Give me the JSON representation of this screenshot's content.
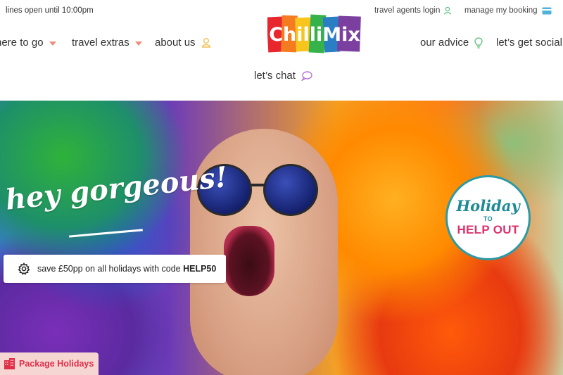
{
  "topbar": {
    "lines_open": "lines open until 10:00pm",
    "agents_login": "travel agents login",
    "manage_booking": "manage my booking"
  },
  "nav": {
    "where_to_go": "here to go",
    "travel_extras": "travel extras",
    "about_us": "about us",
    "our_advice": "our advice",
    "lets_get_social": "let’s get social",
    "lets_chat": "let’s chat"
  },
  "logo": {
    "text": "ChilliMix",
    "colors": [
      "#e8262d",
      "#f47b20",
      "#f7c51e",
      "#36b24a",
      "#2a7ec3",
      "#7b3fa0"
    ]
  },
  "hero": {
    "headline": "hey gorgeous!",
    "promo_text": "save £50pp on all holidays with code ",
    "promo_code": "HELP50",
    "badge": {
      "line1": "Holiday",
      "line2": "TO",
      "line3": "HELP OUT"
    },
    "package_button": "Package Holidays"
  },
  "icons": {
    "agents_login": "user-icon",
    "manage_booking": "card-icon",
    "about_us": "user-icon",
    "our_advice": "lightbulb-icon",
    "lets_chat": "speech-bubble-icon",
    "promo": "gear-icon",
    "package": "building-icon"
  },
  "colors": {
    "caret": "#ef8c7a",
    "badge_teal": "#1d8a96",
    "badge_pink": "#e0306a",
    "package_bg": "#f6d6d2",
    "package_text": "#e0304a"
  }
}
